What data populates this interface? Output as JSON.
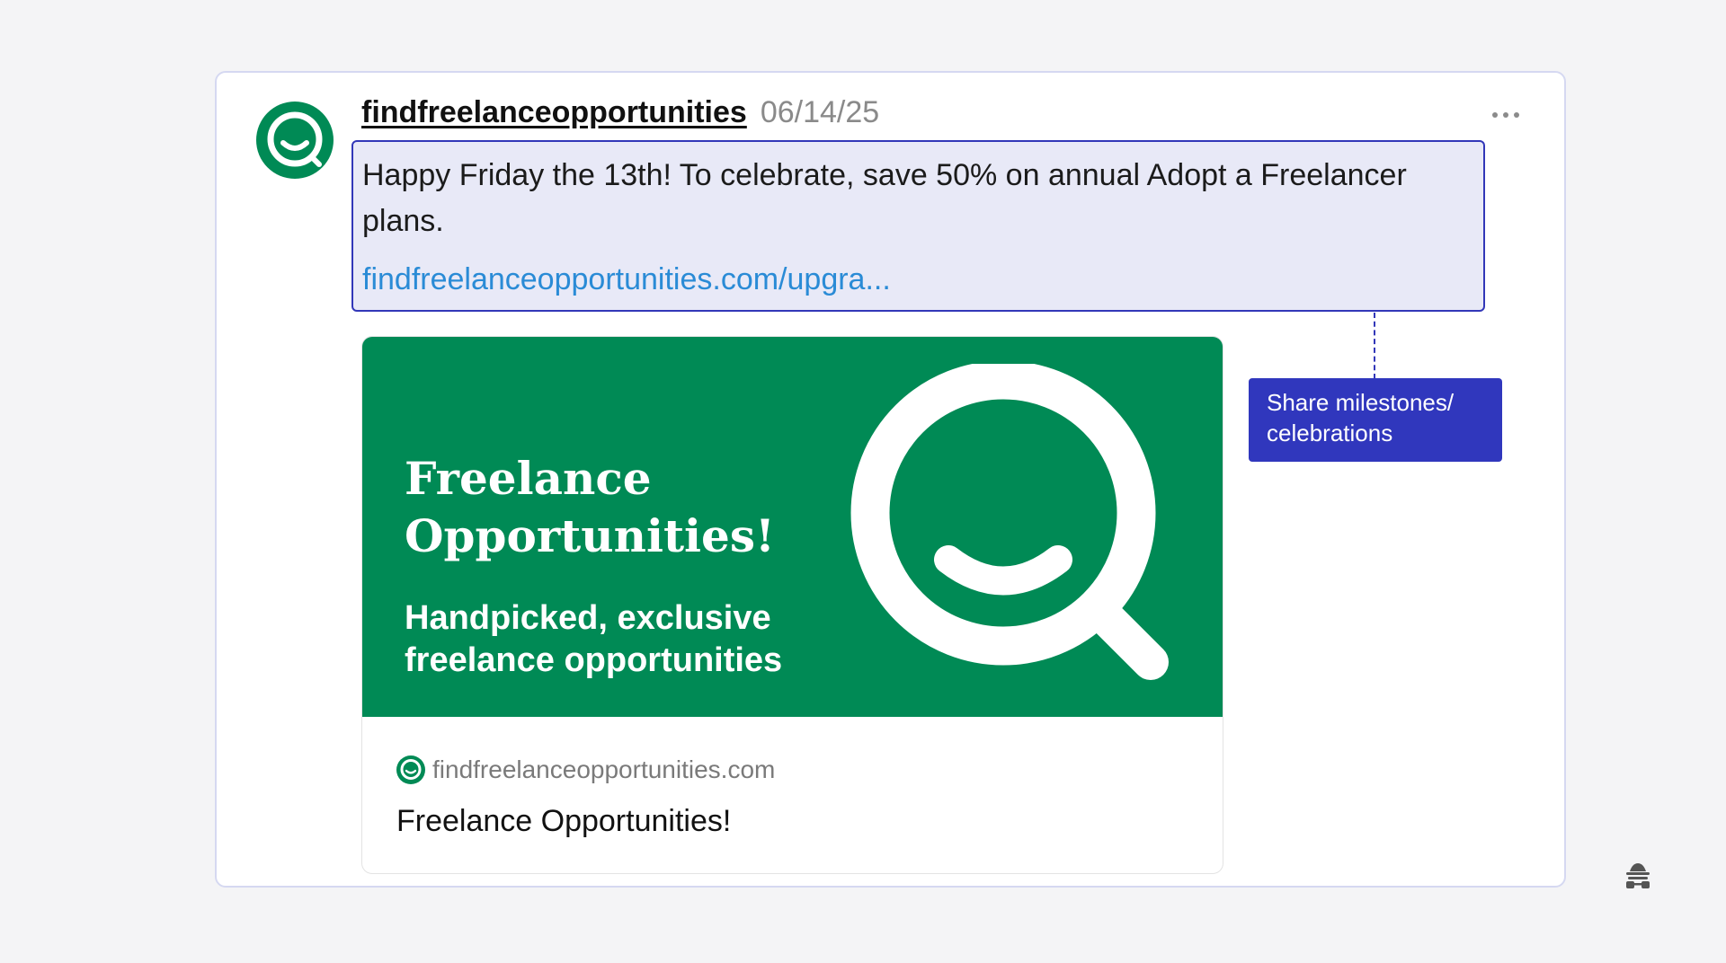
{
  "post": {
    "username": "findfreelanceopportunities",
    "date": "06/14/25",
    "text": "Happy Friday the 13th! To celebrate, save 50% on annual Adopt a Freelancer plans.",
    "link": "findfreelanceopportunities.com/upgra..."
  },
  "annotation": {
    "label": "Share milestones/ celebrations"
  },
  "link_preview": {
    "banner_title": "Freelance Opportunities!",
    "banner_subtitle": "Handpicked, exclusive freelance opportunities",
    "domain": "findfreelanceopportunities.com",
    "title": "Freelance Opportunities!"
  },
  "icons": {
    "avatar": "smiling-magnifier-logo",
    "menu": "more-options-icon",
    "corner": "incognito-icon"
  },
  "colors": {
    "brand_green": "#008a55",
    "accent_blue": "#3237b8",
    "highlight_bg": "#e8e9f7",
    "link_blue": "#2a8bd6"
  }
}
